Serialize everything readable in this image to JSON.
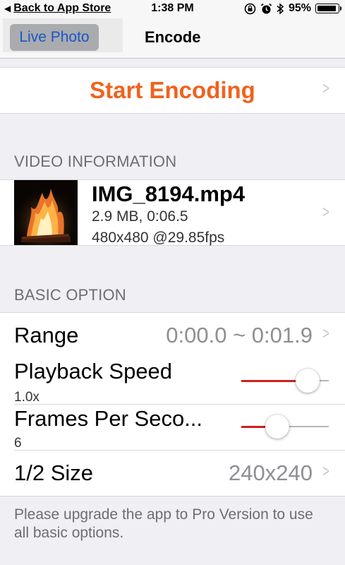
{
  "status_bar": {
    "back_label": "Back to App Store",
    "time": "1:38 PM",
    "battery": "95%",
    "battery_level": 0.95
  },
  "nav": {
    "left_button": "Live Photo",
    "title": "Encode"
  },
  "start": {
    "label": "Start Encoding"
  },
  "video_section": {
    "header": "VIDEO INFORMATION",
    "filename": "IMG_8194.mp4",
    "size_duration": "2.9 MB, 0:06.5",
    "resolution_fps": "480x480 @29.85fps"
  },
  "basic_section": {
    "header": "BASIC OPTION",
    "range": {
      "label": "Range",
      "value": "0:00.0 ~ 0:01.9"
    },
    "playback_speed": {
      "label": "Playback Speed",
      "value": "1.0x",
      "slider_fraction": 0.85
    },
    "frames_per_second": {
      "label": "Frames Per Seco...",
      "value": "6",
      "slider_fraction": 0.38
    },
    "half_size": {
      "label": "1/2 Size",
      "value": "240x240"
    }
  },
  "footer": {
    "note": "Please upgrade the app to Pro Version to use all basic options."
  },
  "colors": {
    "accent_orange": "#f0621e",
    "slider_red": "#d0211c",
    "link_blue": "#1a55c8"
  }
}
